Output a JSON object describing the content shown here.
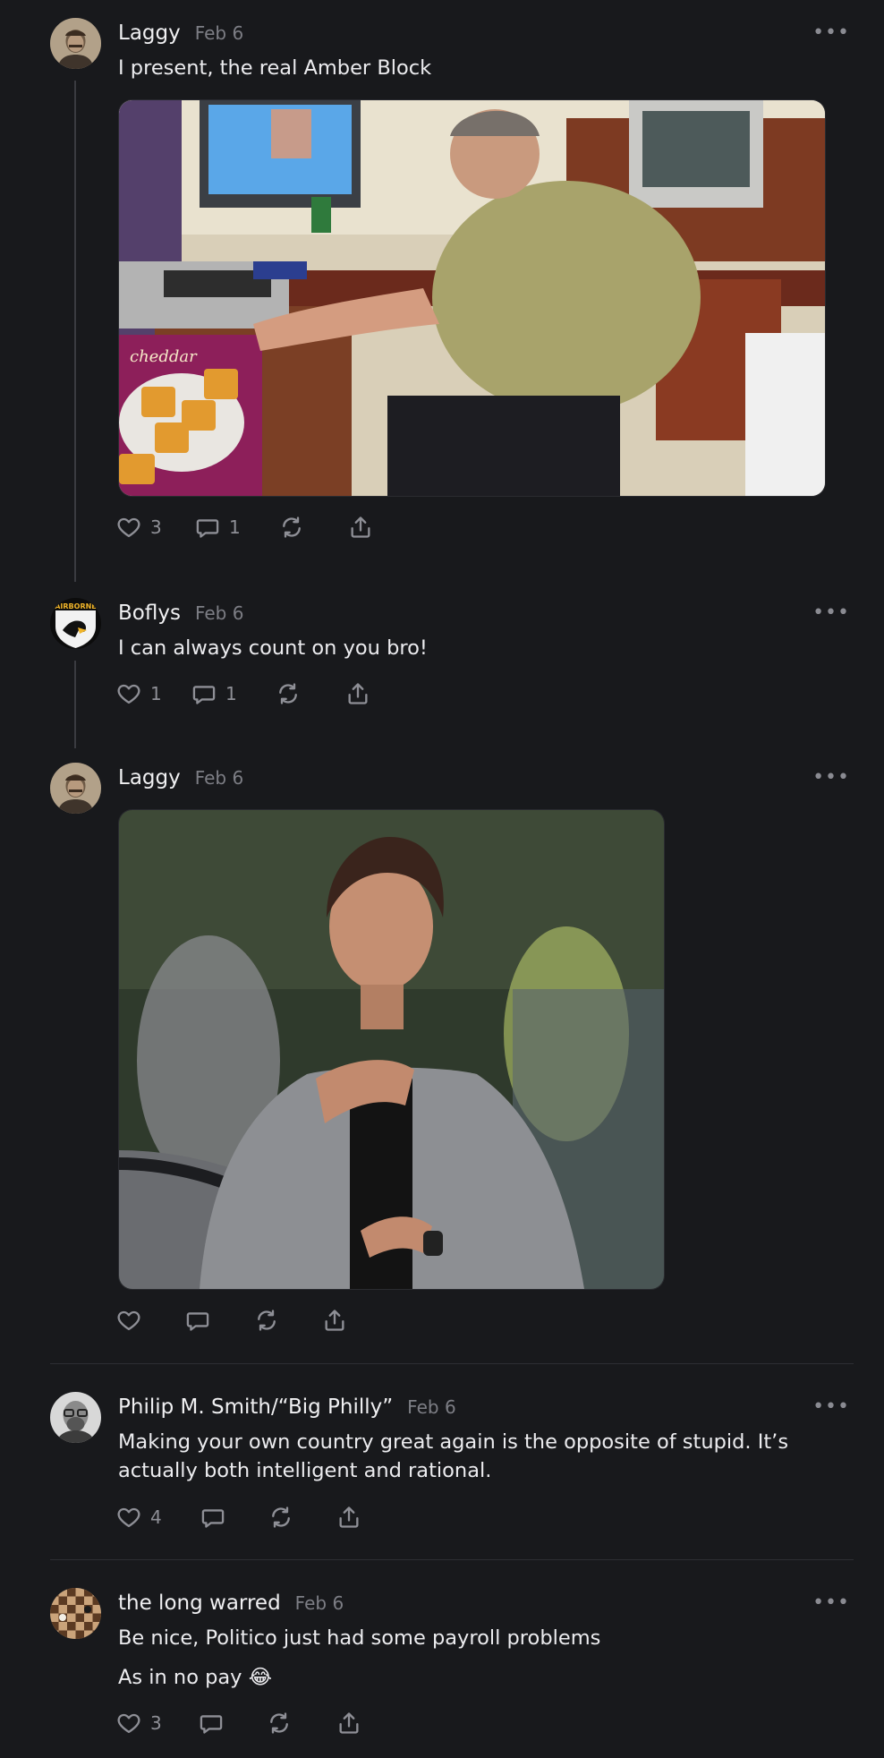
{
  "posts": [
    {
      "author": "Laggy",
      "date": "Feb 6",
      "text": "I present, the real Amber Block",
      "media_alt": "Man in olive t-shirt typing at an office desk with computers and a box of cheddar crackers",
      "likes": "3",
      "replies": "1"
    },
    {
      "author": "Boflys",
      "date": "Feb 6",
      "text": "I can always count on you bro!",
      "likes": "1",
      "replies": "1"
    },
    {
      "author": "Laggy",
      "date": "Feb 6",
      "media_alt": "Man in grey suit with eyes closed, hand on chest, relieved",
      "likes": "",
      "replies": ""
    },
    {
      "author": "Philip M. Smith/“Big Philly”",
      "date": "Feb 6",
      "text": "Making your own country great again is the opposite of stupid. It’s actually both intelligent and rational.",
      "likes": "4",
      "replies": ""
    },
    {
      "author": "the long warred",
      "date": "Feb 6",
      "text": "Be nice, Politico just had some payroll problems",
      "text2": "As in no pay 😂",
      "likes": "3",
      "replies": ""
    }
  ],
  "ui": {
    "more_label": "•••",
    "avatar_badge": "AIRBORNE"
  },
  "colors": {
    "background": "#18191c",
    "muted": "#8e8f96",
    "text": "#ececef"
  }
}
